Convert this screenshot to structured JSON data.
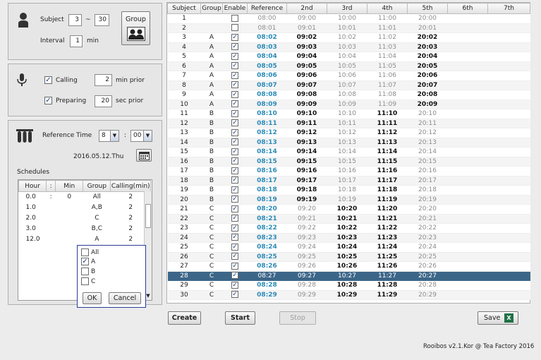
{
  "subject": {
    "label": "Subject",
    "from": "3",
    "sep": "~",
    "to": "30",
    "group_button": "Group"
  },
  "interval": {
    "label": "Interval",
    "value": "1",
    "unit": "min"
  },
  "calling": {
    "label": "Calling",
    "checked": true,
    "value": "2",
    "unit": "min prior"
  },
  "preparing": {
    "label": "Preparing",
    "checked": true,
    "value": "20",
    "unit": "sec prior"
  },
  "reference_time": {
    "label": "Reference Time",
    "hour": "8",
    "sep": ":",
    "minute": "00",
    "date": "2016.05.12.Thu"
  },
  "schedules": {
    "label": "Schedules",
    "columns": [
      "Hour",
      ":",
      "Min",
      "Group",
      "Calling(min)"
    ],
    "rows": [
      {
        "hour": "0.0",
        "colon": ":",
        "min": "0",
        "group": "All",
        "calling": "2"
      },
      {
        "hour": "1.0",
        "colon": "",
        "min": "",
        "group": "A,B",
        "calling": "2"
      },
      {
        "hour": "2.0",
        "colon": "",
        "min": "",
        "group": "C",
        "calling": "2"
      },
      {
        "hour": "3.0",
        "colon": "",
        "min": "",
        "group": "B,C",
        "calling": "2"
      },
      {
        "hour": "12.0",
        "colon": "",
        "min": "",
        "group": "A",
        "calling": "2"
      }
    ],
    "dropdown": {
      "items": [
        {
          "label": "All",
          "checked": false
        },
        {
          "label": "A",
          "checked": true
        },
        {
          "label": "B",
          "checked": false
        },
        {
          "label": "C",
          "checked": false
        }
      ],
      "ok": "OK",
      "cancel": "Cancel"
    }
  },
  "grid": {
    "columns": [
      "Subject",
      "Group",
      "Enable",
      "Reference",
      "2nd",
      "3rd",
      "4th",
      "5th",
      "6th",
      "7th"
    ],
    "selected_row": 28,
    "rows": [
      [
        "1",
        "",
        "0",
        "08:00",
        "09:00",
        "10:00",
        "11:00",
        "20:00"
      ],
      [
        "2",
        "",
        "0",
        "08:01",
        "09:01",
        "10:01",
        "11:01",
        "20:01"
      ],
      [
        "3",
        "A",
        "1",
        "08:02",
        "09:02",
        "10:02",
        "11:02",
        "20:02"
      ],
      [
        "4",
        "A",
        "1",
        "08:03",
        "09:03",
        "10:03",
        "11:03",
        "20:03"
      ],
      [
        "5",
        "A",
        "1",
        "08:04",
        "09:04",
        "10:04",
        "11:04",
        "20:04"
      ],
      [
        "6",
        "A",
        "1",
        "08:05",
        "09:05",
        "10:05",
        "11:05",
        "20:05"
      ],
      [
        "7",
        "A",
        "1",
        "08:06",
        "09:06",
        "10:06",
        "11:06",
        "20:06"
      ],
      [
        "8",
        "A",
        "1",
        "08:07",
        "09:07",
        "10:07",
        "11:07",
        "20:07"
      ],
      [
        "9",
        "A",
        "1",
        "08:08",
        "09:08",
        "10:08",
        "11:08",
        "20:08"
      ],
      [
        "10",
        "A",
        "1",
        "08:09",
        "09:09",
        "10:09",
        "11:09",
        "20:09"
      ],
      [
        "11",
        "B",
        "1",
        "08:10",
        "09:10",
        "10:10",
        "11:10",
        "20:10"
      ],
      [
        "12",
        "B",
        "1",
        "08:11",
        "09:11",
        "10:11",
        "11:11",
        "20:11"
      ],
      [
        "13",
        "B",
        "1",
        "08:12",
        "09:12",
        "10:12",
        "11:12",
        "20:12"
      ],
      [
        "14",
        "B",
        "1",
        "08:13",
        "09:13",
        "10:13",
        "11:13",
        "20:13"
      ],
      [
        "15",
        "B",
        "1",
        "08:14",
        "09:14",
        "10:14",
        "11:14",
        "20:14"
      ],
      [
        "16",
        "B",
        "1",
        "08:15",
        "09:15",
        "10:15",
        "11:15",
        "20:15"
      ],
      [
        "17",
        "B",
        "1",
        "08:16",
        "09:16",
        "10:16",
        "11:16",
        "20:16"
      ],
      [
        "18",
        "B",
        "1",
        "08:17",
        "09:17",
        "10:17",
        "11:17",
        "20:17"
      ],
      [
        "19",
        "B",
        "1",
        "08:18",
        "09:18",
        "10:18",
        "11:18",
        "20:18"
      ],
      [
        "20",
        "B",
        "1",
        "08:19",
        "09:19",
        "10:19",
        "11:19",
        "20:19"
      ],
      [
        "21",
        "C",
        "1",
        "08:20",
        "09:20",
        "10:20",
        "11:20",
        "20:20"
      ],
      [
        "22",
        "C",
        "1",
        "08:21",
        "09:21",
        "10:21",
        "11:21",
        "20:21"
      ],
      [
        "23",
        "C",
        "1",
        "08:22",
        "09:22",
        "10:22",
        "11:22",
        "20:22"
      ],
      [
        "24",
        "C",
        "1",
        "08:23",
        "09:23",
        "10:23",
        "11:23",
        "20:23"
      ],
      [
        "25",
        "C",
        "1",
        "08:24",
        "09:24",
        "10:24",
        "11:24",
        "20:24"
      ],
      [
        "26",
        "C",
        "1",
        "08:25",
        "09:25",
        "10:25",
        "11:25",
        "20:25"
      ],
      [
        "27",
        "C",
        "1",
        "08:26",
        "09:26",
        "10:26",
        "11:26",
        "20:26"
      ],
      [
        "28",
        "C",
        "1",
        "08:27",
        "09:27",
        "10:27",
        "11:27",
        "20:27"
      ],
      [
        "29",
        "C",
        "1",
        "08:28",
        "09:28",
        "10:28",
        "11:28",
        "20:28"
      ],
      [
        "30",
        "C",
        "1",
        "08:29",
        "09:29",
        "10:29",
        "11:29",
        "20:29"
      ]
    ]
  },
  "buttons": {
    "create": "Create",
    "start": "Start",
    "stop": "Stop",
    "save": "Save"
  },
  "footer": "Rooibos v2.1.Kor @ Tea Factory 2016",
  "colors": {
    "accent_blue": "#2a8ab8",
    "selected_row": "#3c6688",
    "dropdown_border": "#2a3a9a",
    "excel_green": "#1e7145"
  }
}
